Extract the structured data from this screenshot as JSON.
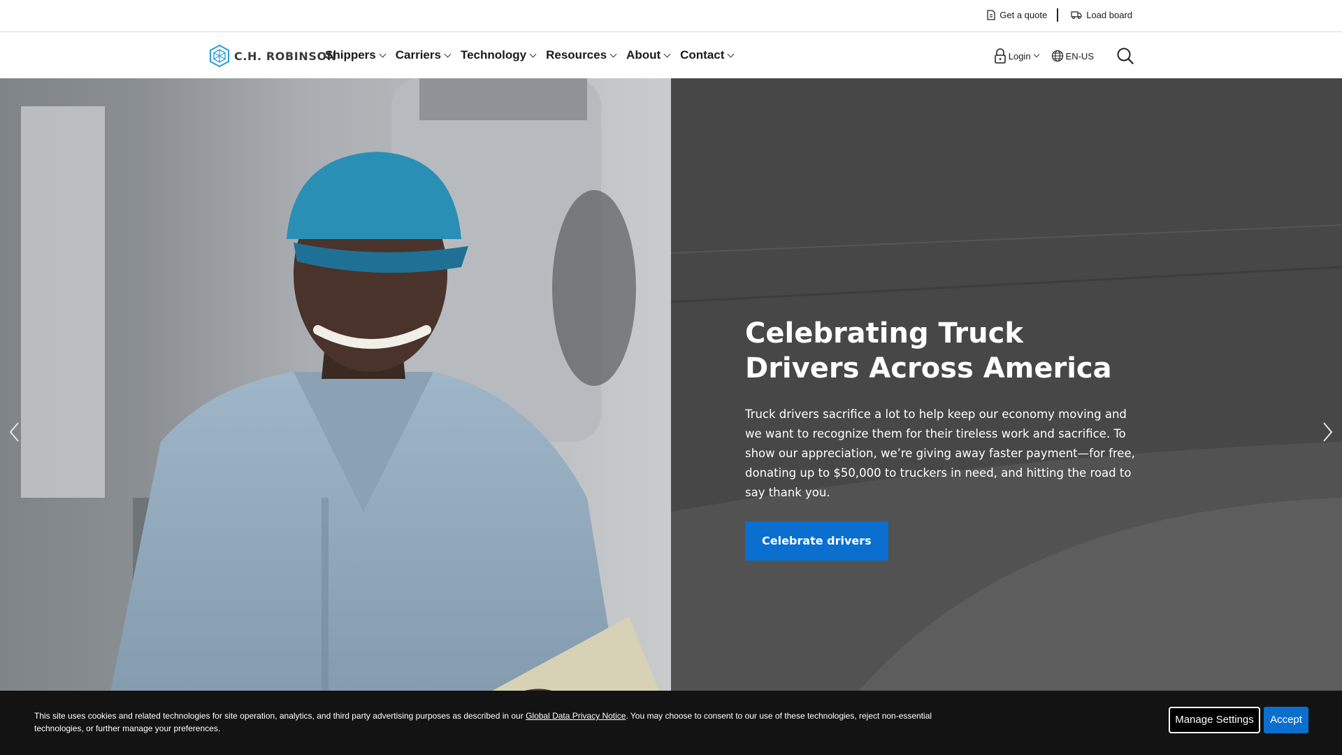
{
  "utility": {
    "get_quote": "Get a quote",
    "load_board": "Load board"
  },
  "brand": {
    "name": "C.H. ROBINSON",
    "color": "#2b9bd6"
  },
  "nav": {
    "items": [
      {
        "label": "Shippers"
      },
      {
        "label": "Carriers"
      },
      {
        "label": "Technology"
      },
      {
        "label": "Resources"
      },
      {
        "label": "About"
      },
      {
        "label": "Contact"
      }
    ],
    "login": "Login",
    "language": "EN-US"
  },
  "hero": {
    "title": "Celebrating Truck Drivers Across America",
    "description": "Truck drivers sacrifice a lot to help keep our economy moving and we want to recognize them for their tireless work and sacrifice. To show our appreciation, we’re giving away faster payment—for free, donating up to $50,000 to truckers in need, and hitting the road to say thank you.",
    "cta": "Celebrate drivers"
  },
  "cookie": {
    "text_before": "This site uses cookies and related technologies for site operation, analytics, and third party advertising purposes as described in our ",
    "link": "Global Data Privacy Notice",
    "text_after": ". You may choose to consent to our use of these technologies, reject non-essential technologies, or further manage your preferences.",
    "manage": "Manage Settings",
    "accept": "Accept"
  },
  "colors": {
    "accent": "#0a6fcf",
    "banner": "#131313"
  }
}
